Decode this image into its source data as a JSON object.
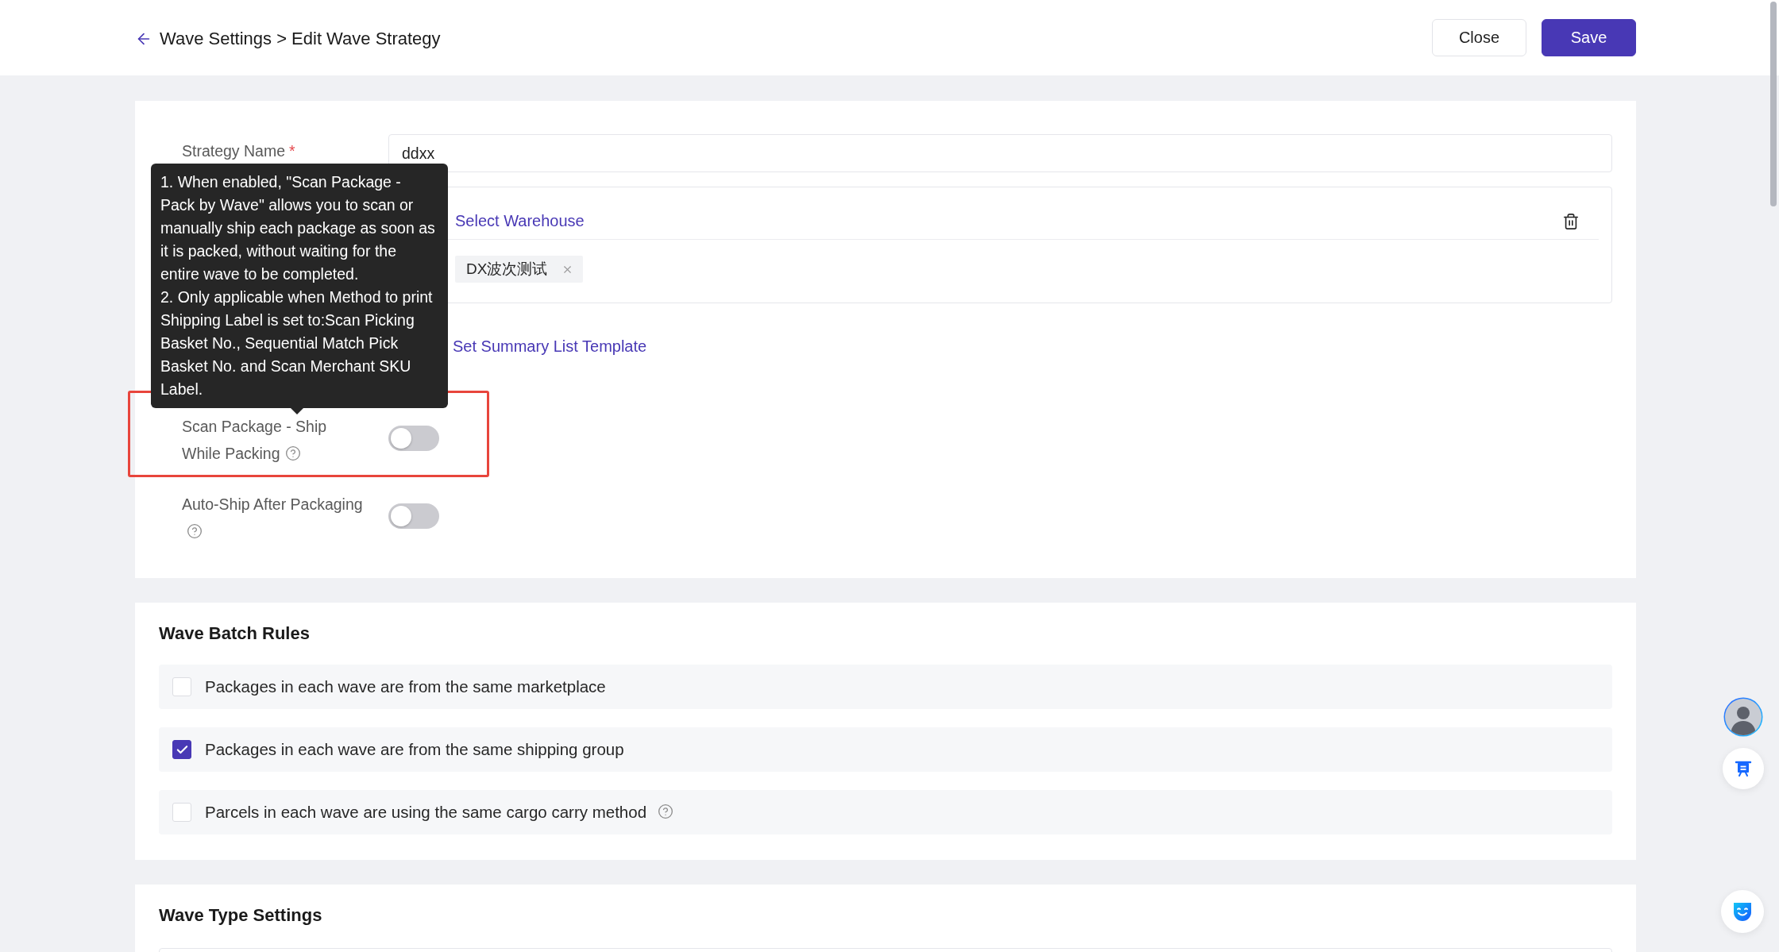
{
  "header": {
    "breadcrumb": "Wave Settings > Edit Wave Strategy",
    "buttons": [
      {
        "label": "Close",
        "kind": "secondary"
      },
      {
        "label": "Save",
        "kind": "primary"
      }
    ]
  },
  "strategy_form": {
    "strategy_name": {
      "label": "Strategy Name",
      "required_mark": "*",
      "value": "ddxx"
    },
    "warehouse": {
      "link": "Select Warehouse",
      "tags": [
        {
          "label": "DX波次测试"
        }
      ]
    },
    "summary_list": {
      "link": "Set Summary List Template"
    },
    "switches": [
      {
        "label": "Scan Package - Ship While Packing",
        "help": true,
        "on": false,
        "highlighted": true
      },
      {
        "label": "Auto-Ship After Packaging",
        "help": true,
        "on": false,
        "highlighted": false
      }
    ],
    "tooltip": {
      "paragraphs": [
        "1. When enabled, \"Scan Package - Pack by Wave\" allows you to scan or manually ship each package as soon as it is packed, without waiting for the entire wave to be completed.",
        "2. Only applicable when Method to print Shipping Label is set to:Scan Picking Basket No., Sequential Match Pick Basket No. and Scan Merchant SKU Label."
      ]
    }
  },
  "wave_batch_rules": {
    "title": "Wave Batch Rules",
    "rules": [
      {
        "label": "Packages in each wave are from the same marketplace",
        "checked": false,
        "help": false
      },
      {
        "label": "Packages in each wave are from the same shipping group",
        "checked": true,
        "help": false
      },
      {
        "label": "Parcels in each wave are using the same cargo carry method",
        "checked": false,
        "help": true
      }
    ]
  },
  "wave_type_settings": {
    "title": "Wave Type Settings"
  }
}
